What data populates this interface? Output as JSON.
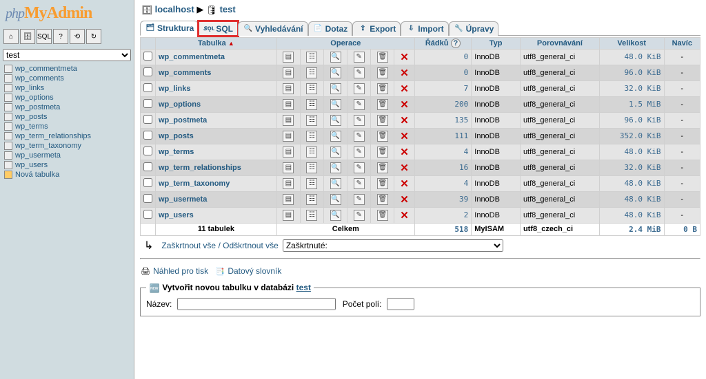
{
  "logo": {
    "part1": "php",
    "part2": "MyAdmin"
  },
  "left_toolbar": [
    "⌂",
    "🗄",
    "SQL",
    "?",
    "⟲",
    "↻"
  ],
  "db_select_value": "test",
  "tree_tables": [
    "wp_commentmeta",
    "wp_comments",
    "wp_links",
    "wp_options",
    "wp_postmeta",
    "wp_posts",
    "wp_terms",
    "wp_term_relationships",
    "wp_term_taxonomy",
    "wp_usermeta",
    "wp_users"
  ],
  "tree_new_label": "Nová tabulka",
  "breadcrumb": {
    "server_label": "localhost",
    "db_label": "test",
    "sep": "▶"
  },
  "tabs": {
    "structure": "Struktura",
    "sql": "SQL",
    "search": "Vyhledávání",
    "query": "Dotaz",
    "export": "Export",
    "import": "Import",
    "operations": "Úpravy"
  },
  "grid": {
    "headers": {
      "table": "Tabulka",
      "operations": "Operace",
      "rows": "Řádků",
      "type": "Typ",
      "collation": "Porovnávání",
      "size": "Velikost",
      "extra": "Navíc"
    },
    "rows": [
      {
        "name": "wp_commentmeta",
        "rows": "0",
        "type": "InnoDB",
        "coll": "utf8_general_ci",
        "size": "48.0 KiB",
        "extra": "-"
      },
      {
        "name": "wp_comments",
        "rows": "0",
        "type": "InnoDB",
        "coll": "utf8_general_ci",
        "size": "96.0 KiB",
        "extra": "-"
      },
      {
        "name": "wp_links",
        "rows": "7",
        "type": "InnoDB",
        "coll": "utf8_general_ci",
        "size": "32.0 KiB",
        "extra": "-"
      },
      {
        "name": "wp_options",
        "rows": "200",
        "type": "InnoDB",
        "coll": "utf8_general_ci",
        "size": "1.5 MiB",
        "extra": "-"
      },
      {
        "name": "wp_postmeta",
        "rows": "135",
        "type": "InnoDB",
        "coll": "utf8_general_ci",
        "size": "96.0 KiB",
        "extra": "-"
      },
      {
        "name": "wp_posts",
        "rows": "111",
        "type": "InnoDB",
        "coll": "utf8_general_ci",
        "size": "352.0 KiB",
        "extra": "-"
      },
      {
        "name": "wp_terms",
        "rows": "4",
        "type": "InnoDB",
        "coll": "utf8_general_ci",
        "size": "48.0 KiB",
        "extra": "-"
      },
      {
        "name": "wp_term_relationships",
        "rows": "16",
        "type": "InnoDB",
        "coll": "utf8_general_ci",
        "size": "32.0 KiB",
        "extra": "-"
      },
      {
        "name": "wp_term_taxonomy",
        "rows": "4",
        "type": "InnoDB",
        "coll": "utf8_general_ci",
        "size": "48.0 KiB",
        "extra": "-"
      },
      {
        "name": "wp_usermeta",
        "rows": "39",
        "type": "InnoDB",
        "coll": "utf8_general_ci",
        "size": "48.0 KiB",
        "extra": "-"
      },
      {
        "name": "wp_users",
        "rows": "2",
        "type": "InnoDB",
        "coll": "utf8_general_ci",
        "size": "48.0 KiB",
        "extra": "-"
      }
    ],
    "footer": {
      "table": "11 tabulek",
      "operations": "Celkem",
      "rows": "518",
      "type": "MyISAM",
      "coll": "utf8_czech_ci",
      "size": "2.4 MiB",
      "extra": "0 B"
    }
  },
  "below": {
    "check_all": "Zaškrtnout vše / Odškrtnout vše",
    "selected_label": "Zaškrtnuté:"
  },
  "print": {
    "print_view": "Náhled pro tisk",
    "data_dict": "Datový slovník"
  },
  "newtable": {
    "legend_prefix": "Vytvořit novou tabulku v databázi ",
    "db": "test",
    "name_label": "Název:",
    "cols_label": "Počet polí:"
  }
}
